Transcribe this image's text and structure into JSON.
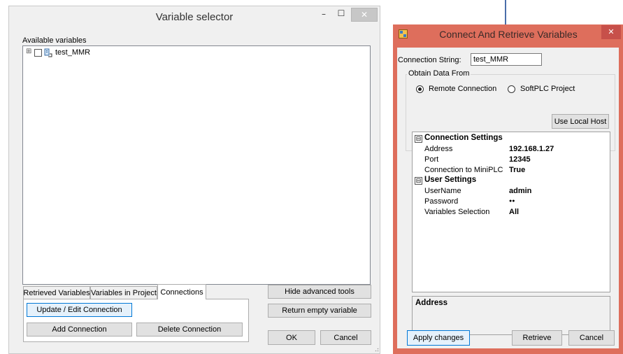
{
  "variable_selector": {
    "title": "Variable selector",
    "minimize_glyph": "–",
    "maximize_glyph": "☐",
    "close_glyph": "✕",
    "available_variables_label": "Available variables",
    "tree_items": [
      {
        "label": "test_MMR",
        "expander": "⊞"
      }
    ],
    "tabs": [
      {
        "label": "Retrieved Variables"
      },
      {
        "label": "Variables in Project"
      },
      {
        "label": "Connections"
      }
    ],
    "buttons": {
      "update_edit": "Update / Edit Connection",
      "add_connection": "Add Connection",
      "delete_connection": "Delete Connection",
      "hide_advanced": "Hide advanced tools",
      "return_empty": "Return empty variable",
      "ok": "OK",
      "cancel": "Cancel"
    }
  },
  "connect_dialog": {
    "title": "Connect And Retrieve Variables",
    "close_glyph": "✕",
    "connection_string_label": "Connection String:",
    "connection_string_value": "test_MMR",
    "obtain_group_label": "Obtain Data From",
    "radio_remote": "Remote Connection",
    "radio_softplc": "SoftPLC Project",
    "use_local_host": "Use Local Host",
    "grid": {
      "connection_settings": {
        "expander": "⊟",
        "title": "Connection Settings",
        "rows": [
          {
            "key": "Address",
            "value": "192.168.1.27"
          },
          {
            "key": "Port",
            "value": "12345"
          },
          {
            "key": "Connection to MiniPLC",
            "value": "True"
          }
        ]
      },
      "user_settings": {
        "expander": "⊟",
        "title": "User Settings",
        "rows": [
          {
            "key": "UserName",
            "value": "admin"
          },
          {
            "key": "Password",
            "value": "●●"
          },
          {
            "key": "Variables Selection",
            "value": "All"
          }
        ]
      }
    },
    "description_title": "Address",
    "buttons": {
      "apply": "Apply changes",
      "retrieve": "Retrieve",
      "cancel": "Cancel"
    }
  },
  "colors": {
    "dialog_border": "#de6e5c",
    "focus_blue": "#0078d7"
  }
}
